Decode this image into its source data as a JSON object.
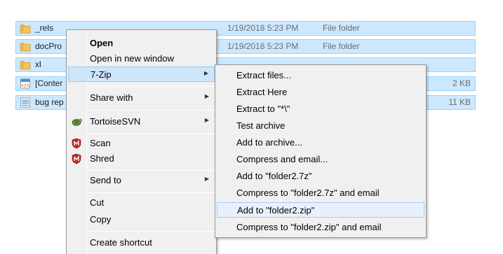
{
  "files": [
    {
      "name": "_rels",
      "date": "1/19/2018 5:23 PM",
      "type": "File folder",
      "size": "",
      "icon": "folder-icon"
    },
    {
      "name": "docPro",
      "date": "1/19/2018 5:23 PM",
      "type": "File folder",
      "size": "",
      "icon": "folder-icon"
    },
    {
      "name": "xl",
      "date": "",
      "type": "",
      "size": "",
      "icon": "folder-icon"
    },
    {
      "name": "[Conter",
      "date": "",
      "type": "",
      "size": "2 KB",
      "icon": "xml-file-icon"
    },
    {
      "name": "bug rep",
      "date": "",
      "type": "",
      "size": "11 KB",
      "icon": "document-file-icon"
    }
  ],
  "context_menu": {
    "open": "Open",
    "open_new_window": "Open in new window",
    "seven_zip": "7-Zip",
    "share_with": "Share with",
    "tortoisesvn": "TortoiseSVN",
    "scan": "Scan",
    "shred": "Shred",
    "send_to": "Send to",
    "cut": "Cut",
    "copy": "Copy",
    "create_shortcut": "Create shortcut"
  },
  "seven_zip_submenu": [
    "Extract files...",
    "Extract Here",
    "Extract to \"*\\\"",
    "Test archive",
    "Add to archive...",
    "Compress and email...",
    "Add to \"folder2.7z\"",
    "Compress to \"folder2.7z\" and email",
    "Add to \"folder2.zip\"",
    "Compress to \"folder2.zip\" and email"
  ],
  "colors": {
    "selection_bg": "#cce8ff",
    "selection_border": "#99d1ff",
    "menu_bg": "#f0f0f0",
    "menu_highlight": "#cfe6fa",
    "folder_yellow": "#f2c55c"
  }
}
